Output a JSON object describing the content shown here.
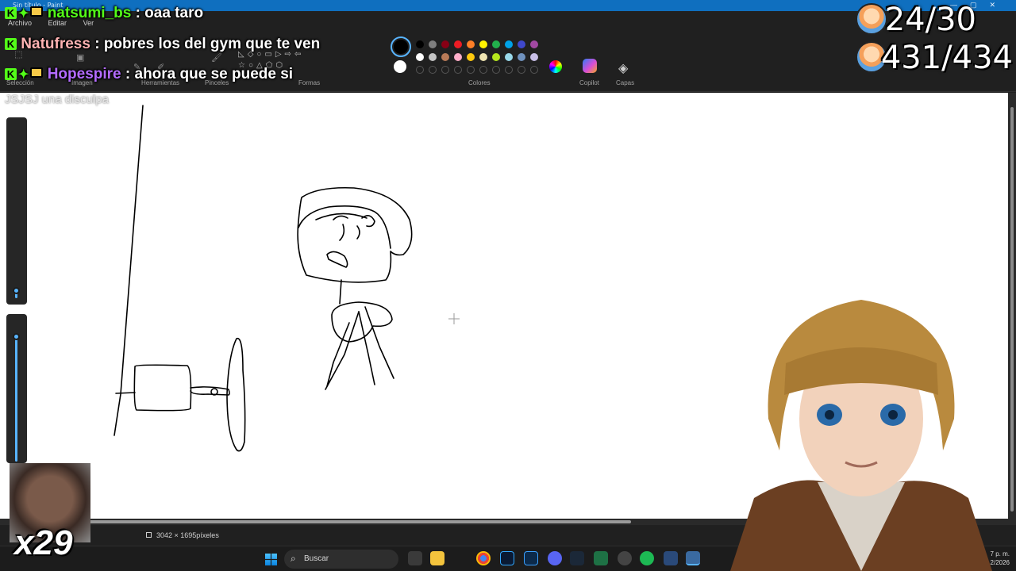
{
  "window": {
    "title": "Sin título - Paint"
  },
  "menu": {
    "file": "Archivo",
    "edit": "Editar",
    "view": "Ver"
  },
  "ribbon": {
    "groups": {
      "selection": "Selección",
      "image": "Imagen",
      "tools": "Herramientas",
      "brushes": "Pinceles",
      "shapes": "Formas",
      "colors": "Colores",
      "copilot": "Copilot",
      "layers": "Capas"
    },
    "selected_colors": {
      "primary": "#000000",
      "secondary": "#ffffff"
    },
    "swatch_rows": [
      [
        "#000000",
        "#7f7f7f",
        "#880015",
        "#ed1c24",
        "#ff7f27",
        "#fff200",
        "#22b14c",
        "#00a2e8",
        "#3f48cc",
        "#a349a4"
      ],
      [
        "#ffffff",
        "#c3c3c3",
        "#b97a57",
        "#ffaec9",
        "#ffc90e",
        "#efe4b0",
        "#b5e61d",
        "#99d9ea",
        "#7092be",
        "#c8bfe7"
      ]
    ]
  },
  "chat": [
    {
      "user": "natsumi_bs",
      "user_color": "#53fc18",
      "message": ": oaa taro"
    },
    {
      "user": "Natufress",
      "user_color": "#ffb3b3",
      "message": ": pobres los del gym que te ven"
    },
    {
      "user": "Hopespire",
      "user_color": "#b36bff",
      "message": ": ahora que se puede si"
    }
  ],
  "overlay_note": "JSJSJ una disculpa",
  "counters": {
    "top": "24/30",
    "bottom": "431/434"
  },
  "status": {
    "dimensions": "3042 × 1695píxeles"
  },
  "taskbar": {
    "search_placeholder": "Buscar",
    "time": "7 p. m.",
    "date": "2/2026"
  },
  "emote": {
    "count": "x29"
  }
}
